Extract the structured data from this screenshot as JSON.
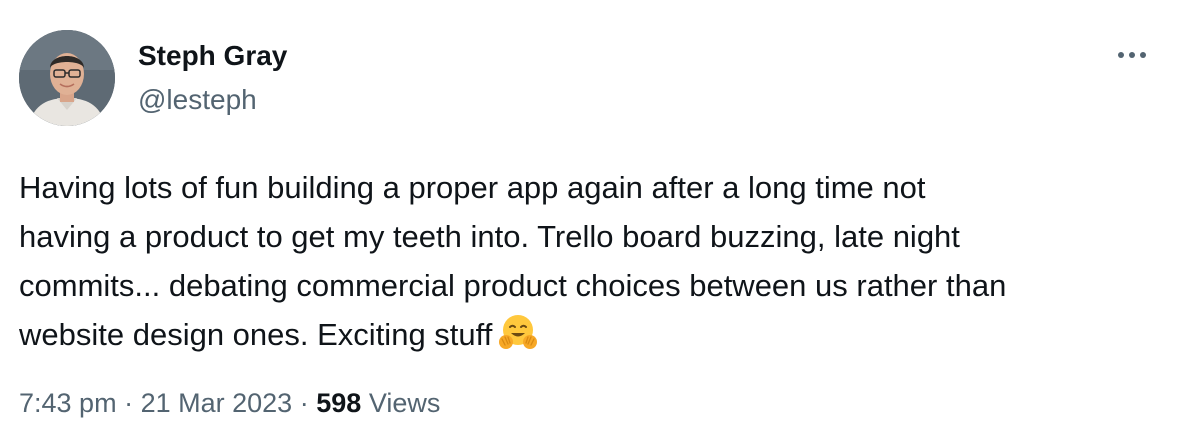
{
  "author": {
    "name": "Steph Gray",
    "handle": "@lesteph",
    "avatar_icon": "profile-photo"
  },
  "more_icon": "more-horizontal-icon",
  "tweet": {
    "text_lines": [
      "Having lots of fun building a proper app again after a long time not",
      "having a product to get my teeth into. Trello board buzzing, late night",
      "commits... debating commercial product choices between us rather than",
      "website design ones. Exciting stuff"
    ],
    "emoji": "hugging-face-emoji"
  },
  "meta": {
    "time": "7:43 pm",
    "separator": "·",
    "date": "21 Mar 2023",
    "views_count": "598",
    "views_label": "Views"
  },
  "colors": {
    "text_primary": "#0f1419",
    "text_secondary": "#536471",
    "background": "#ffffff",
    "emoji_yellow": "#ffc83d"
  }
}
